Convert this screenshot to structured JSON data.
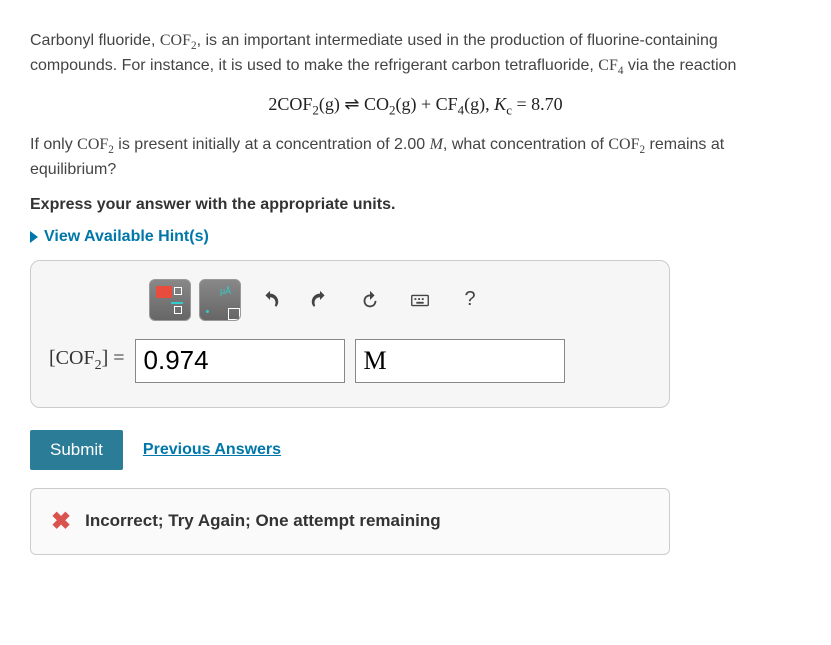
{
  "problem": {
    "p1_a": "Carbonyl fluoride, ",
    "p1_chem1": "COF",
    "p1_sub1": "2",
    "p1_b": ", is an important intermediate used in the production of fluorine-containing compounds. For instance, it is used to make the refrigerant carbon tetrafluoride, ",
    "p1_chem2": "CF",
    "p1_sub2": "4",
    "p1_c": " via the reaction",
    "equation_lhs_coef": "2",
    "equation_lhs": "COF",
    "equation_lhs_sub": "2",
    "equation_phase": "(g)",
    "equation_arrow": " ⇌ ",
    "equation_rhs1": "CO",
    "equation_rhs1_sub": "2",
    "equation_plus": " + ",
    "equation_rhs2": "CF",
    "equation_rhs2_sub": "4",
    "equation_comma": ",    ",
    "equation_k_sym": "K",
    "equation_k_sub": "c",
    "equation_k_eq": " = ",
    "equation_k_val": "8.70",
    "p2_a": "If only ",
    "p2_chem": "COF",
    "p2_sub": "2",
    "p2_b": " is present initially at a concentration of 2.00 ",
    "p2_unit": "M",
    "p2_c": ", what concentration of ",
    "p2_chem2": "COF",
    "p2_sub2": "2",
    "p2_d": " remains at equilibrium?"
  },
  "instruction": "Express your answer with the appropriate units.",
  "hints_label": "View Available Hint(s)",
  "toolbar": {
    "units_label": "μÅ",
    "help": "?"
  },
  "answer": {
    "label_open": "[",
    "label_chem": "COF",
    "label_sub": "2",
    "label_close": "] = ",
    "value": "0.974",
    "unit": "M"
  },
  "buttons": {
    "submit": "Submit",
    "prev": "Previous Answers"
  },
  "feedback": {
    "text": "Incorrect; Try Again; One attempt remaining"
  }
}
